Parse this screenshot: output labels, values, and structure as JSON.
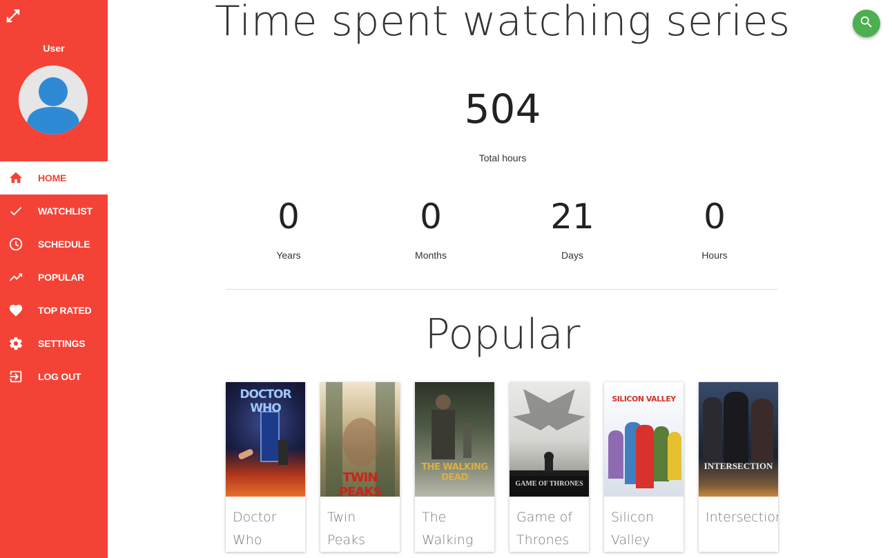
{
  "sidebar": {
    "user_name": "User",
    "nav": [
      {
        "label": "HOME",
        "icon": "home-icon",
        "active": true
      },
      {
        "label": "WATCHLIST",
        "icon": "check-icon",
        "active": false
      },
      {
        "label": "SCHEDULE",
        "icon": "clock-icon",
        "active": false
      },
      {
        "label": "POPULAR",
        "icon": "trending-up-icon",
        "active": false
      },
      {
        "label": "TOP RATED",
        "icon": "heart-icon",
        "active": false
      },
      {
        "label": "SETTINGS",
        "icon": "gear-icon",
        "active": false
      },
      {
        "label": "LOG OUT",
        "icon": "logout-icon",
        "active": false
      }
    ]
  },
  "main": {
    "title": "Time spent watching series",
    "total": {
      "value": "504",
      "label": "Total hours"
    },
    "breakdown": [
      {
        "value": "0",
        "label": "Years"
      },
      {
        "value": "0",
        "label": "Months"
      },
      {
        "value": "21",
        "label": "Days"
      },
      {
        "value": "0",
        "label": "Hours"
      }
    ],
    "popular_title": "Popular",
    "popular": [
      {
        "title": "Doctor Who",
        "poster_text": "DOCTOR WHO"
      },
      {
        "title": "Twin Peaks",
        "poster_text": "TWIN PEAKS"
      },
      {
        "title": "The Walking Dead",
        "poster_text": "THE WALKING DEAD"
      },
      {
        "title": "Game of Thrones",
        "poster_text": "GAME OF THRONES"
      },
      {
        "title": "Silicon Valley",
        "poster_text": "SILICON VALLEY"
      },
      {
        "title": "Intersection",
        "poster_text": "INTERSECTION"
      }
    ]
  },
  "colors": {
    "sidebar": "#f44336",
    "fab": "#4caf50",
    "avatar": "#2f8ad5"
  }
}
